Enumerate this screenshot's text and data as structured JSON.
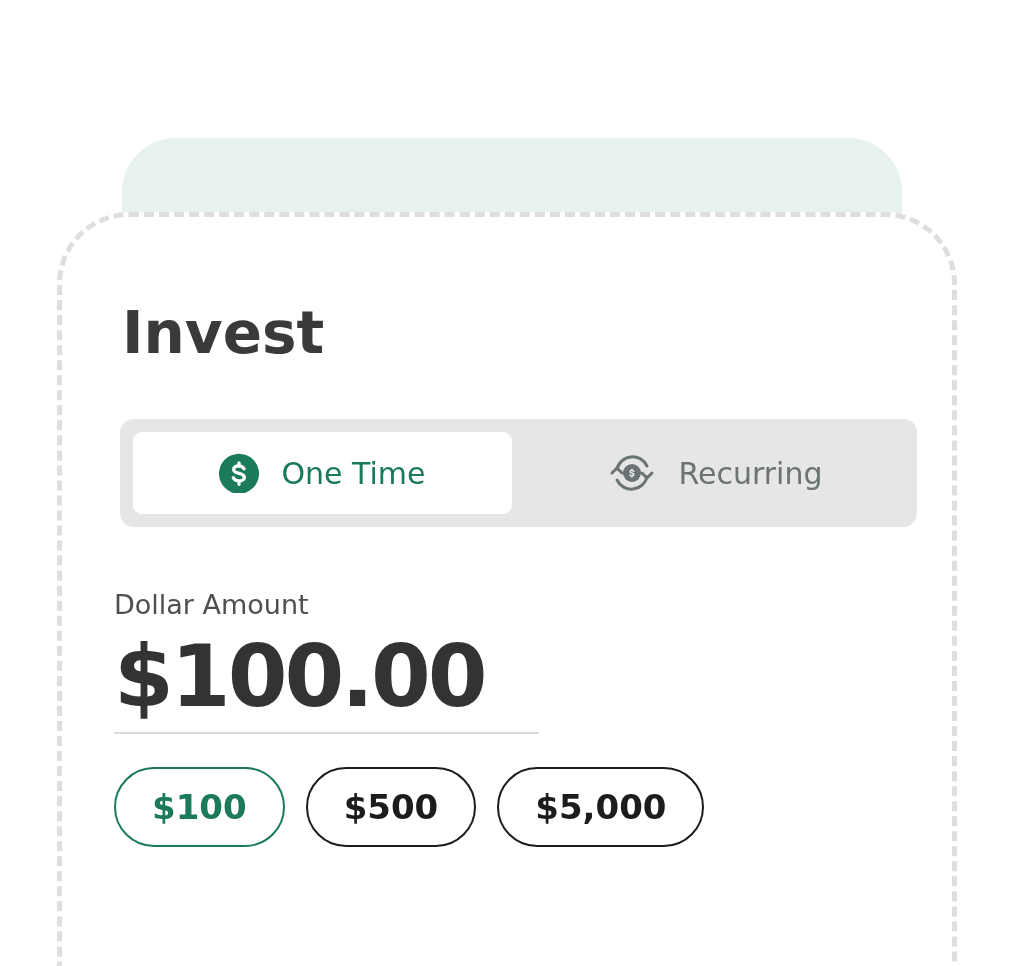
{
  "title": "Invest",
  "tabs": [
    {
      "label": "One Time",
      "kind": "one-time",
      "selected": true
    },
    {
      "label": "Recurring",
      "kind": "recurring",
      "selected": false
    }
  ],
  "amount": {
    "label": "Dollar Amount",
    "value": "$100.00"
  },
  "presets": [
    {
      "label": "$100",
      "selected": true
    },
    {
      "label": "$500",
      "selected": false
    },
    {
      "label": "$5,000",
      "selected": false
    }
  ]
}
